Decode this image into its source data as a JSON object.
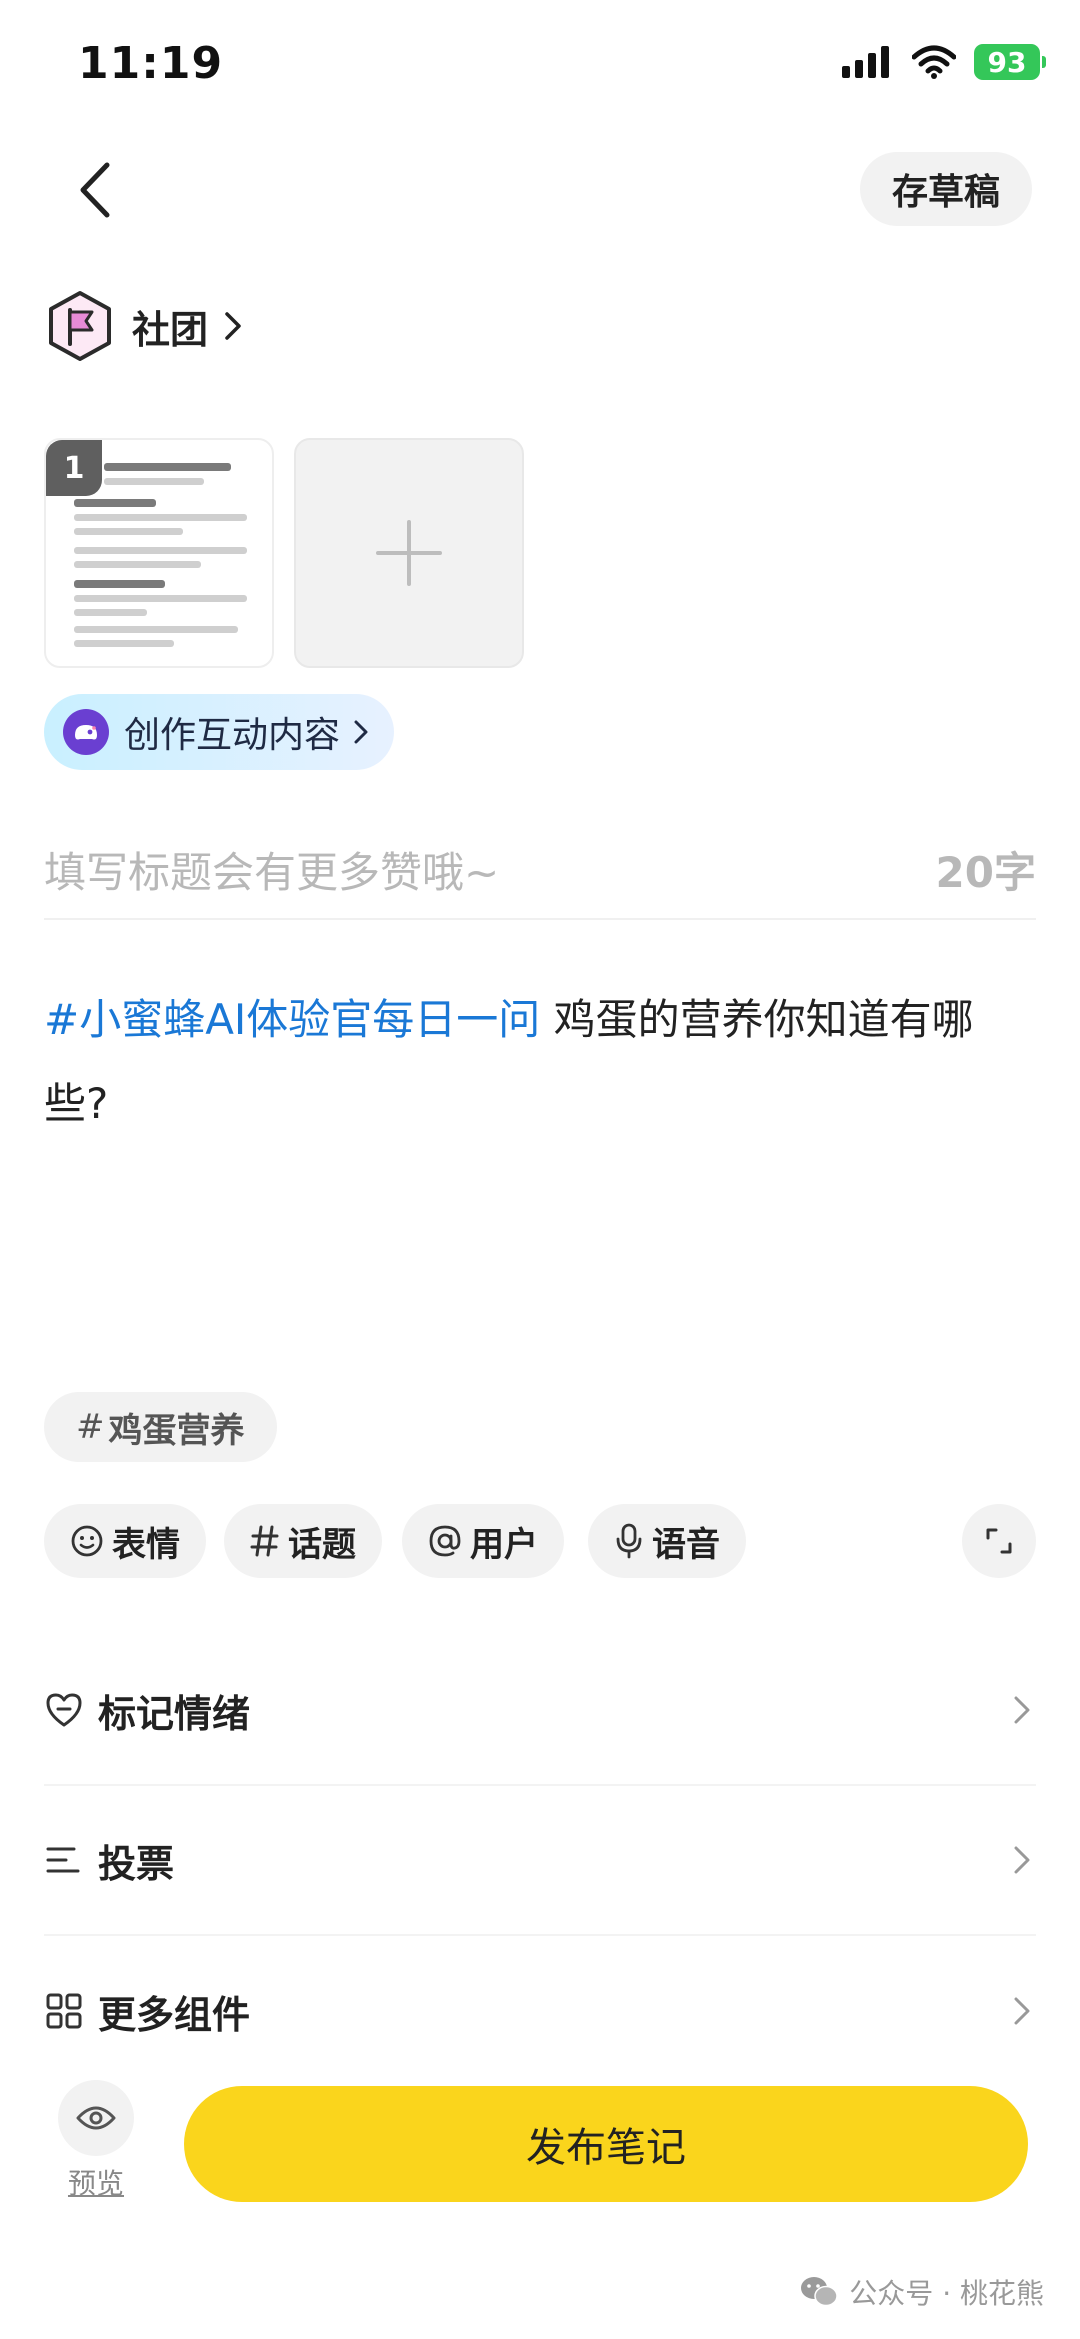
{
  "status": {
    "time": "11:19",
    "battery": "93"
  },
  "header": {
    "draft_label": "存草稿"
  },
  "community": {
    "label": "社团"
  },
  "media": {
    "count_badge": "1"
  },
  "interactive": {
    "label": "创作互动内容"
  },
  "title": {
    "placeholder": "填写标题会有更多赞哦~",
    "count": "20字"
  },
  "body": {
    "hashtag": "#小蜜蜂AI体验官每日一问",
    "text": " 鸡蛋的营养你知道有哪些?"
  },
  "topic_chip": {
    "symbol": "#",
    "label": "鸡蛋营养"
  },
  "tools": [
    {
      "label": "表情",
      "icon": "emoji-icon"
    },
    {
      "label": "话题",
      "icon": "hash-icon"
    },
    {
      "label": "用户",
      "icon": "at-icon"
    },
    {
      "label": "语音",
      "icon": "mic-icon"
    }
  ],
  "options": [
    {
      "label": "标记情绪",
      "icon": "heart-face-icon"
    },
    {
      "label": "投票",
      "icon": "poll-icon"
    },
    {
      "label": "更多组件",
      "icon": "grid-icon"
    }
  ],
  "footer": {
    "preview_label": "预览",
    "publish_label": "发布笔记"
  },
  "watermark": {
    "text": "公众号 · 桃花熊"
  },
  "colors": {
    "accent_yellow": "#fad51c",
    "hashtag_blue": "#1a78d6",
    "battery_green": "#34c759"
  }
}
